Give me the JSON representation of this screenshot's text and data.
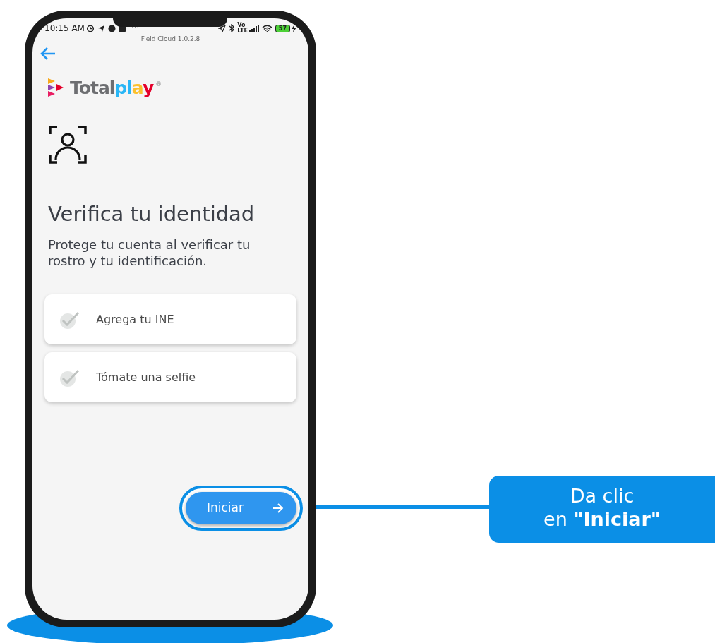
{
  "status_bar": {
    "time": "10:15 AM",
    "more": "···",
    "network_label": [
      "Vo",
      "LTE"
    ],
    "battery": "57"
  },
  "app_title": "Field Cloud 1.0.2.8",
  "logo": {
    "text": "Totalplay",
    "mark": "®"
  },
  "title": "Verifica tu identidad",
  "subtitle": "Protege tu cuenta al verificar tu rostro y tu identificación.",
  "steps": [
    {
      "label": "Agrega tu INE",
      "checked": false
    },
    {
      "label": "Tómate una selfie",
      "checked": false
    }
  ],
  "start_button": {
    "label": "Iniciar",
    "highlighted": true
  },
  "callout": {
    "lines": [
      "Da clic",
      "en **\"Iniciar\"**"
    ]
  }
}
